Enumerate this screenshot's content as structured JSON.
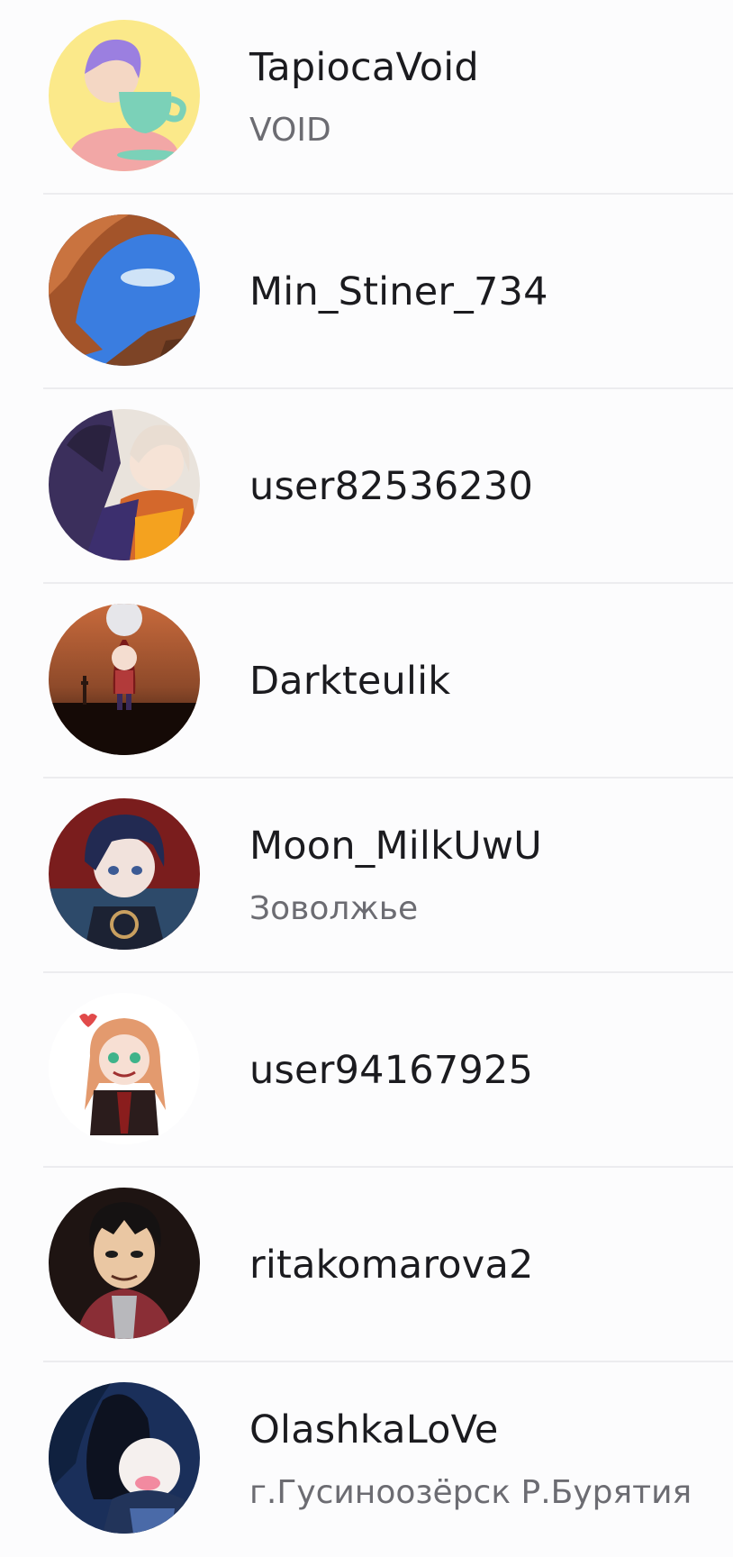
{
  "users": [
    {
      "username": "TapiocaVoid",
      "subtitle": "VOID"
    },
    {
      "username": "Min_Stiner_734",
      "subtitle": ""
    },
    {
      "username": "user82536230",
      "subtitle": ""
    },
    {
      "username": "Darkteulik",
      "subtitle": ""
    },
    {
      "username": "Moon_MilkUwU",
      "subtitle": "Зоволжье"
    },
    {
      "username": "user94167925",
      "subtitle": ""
    },
    {
      "username": "ritakomarova2",
      "subtitle": ""
    },
    {
      "username": "OlashkaLoVe",
      "subtitle": "г.Гусиноозёрск Р.Бурятия"
    }
  ]
}
